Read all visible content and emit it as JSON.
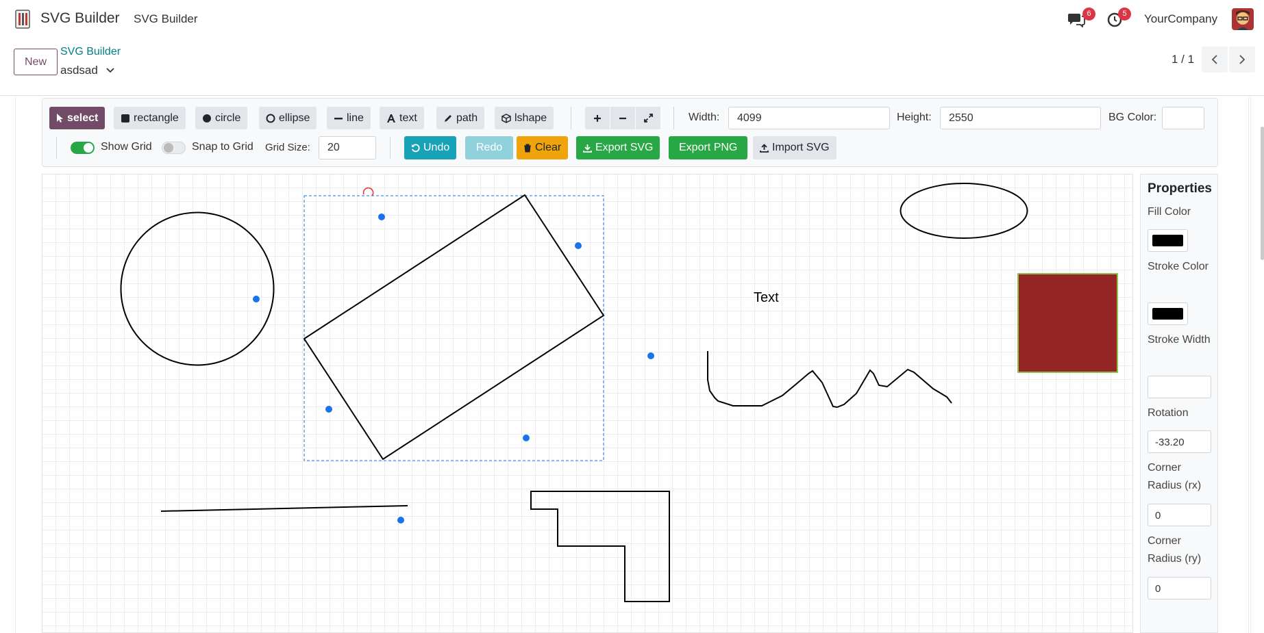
{
  "topbar": {
    "app_title": "SVG Builder",
    "menu_item": "SVG Builder",
    "messages_badge": "6",
    "activities_badge": "5",
    "company": "YourCompany"
  },
  "controlbar": {
    "new_label": "New",
    "breadcrumb_link": "SVG Builder",
    "record_name": "asdsad",
    "pager": "1 / 1"
  },
  "toolbar": {
    "tools": {
      "select": "select",
      "rectangle": "rectangle",
      "circle": "circle",
      "ellipse": "ellipse",
      "line": "line",
      "text": "text",
      "path": "path",
      "lshape": "lshape"
    },
    "active_tool": "select",
    "width_label": "Width:",
    "width_value": "4099",
    "height_label": "Height:",
    "height_value": "2550",
    "bg_label": "BG Color:",
    "show_grid_label": "Show Grid",
    "show_grid_on": true,
    "snap_label": "Snap to Grid",
    "snap_on": false,
    "grid_size_label": "Grid Size:",
    "grid_size_value": "20",
    "undo_label": "Undo",
    "redo_label": "Redo",
    "clear_label": "Clear",
    "export_svg_label": "Export SVG",
    "export_png_label": "Export PNG",
    "import_svg_label": "Import SVG",
    "colors": {
      "select_active": "#714b67",
      "undo": "#17a2b8",
      "redo": "#8fd2dd",
      "clear": "#f0a30a",
      "export": "#28a745",
      "import": "#e2e6ea"
    }
  },
  "canvas": {
    "text_shape_content": "Text",
    "square_fill": "#962626",
    "square_stroke": "#8bc34a",
    "handle_color": "#1a73e8",
    "selection_color": "#1a73e8"
  },
  "properties": {
    "title": "Properties",
    "fill_color_label": "Fill Color",
    "stroke_color_label": "Stroke Color",
    "stroke_width_label": "Stroke Width",
    "stroke_width_value": "",
    "rotation_label": "Rotation",
    "rotation_value": "-33.20",
    "corner_rx_label": "Corner Radius (rx)",
    "corner_rx_value": "0",
    "corner_ry_label": "Corner Radius (ry)",
    "corner_ry_value": "0"
  }
}
